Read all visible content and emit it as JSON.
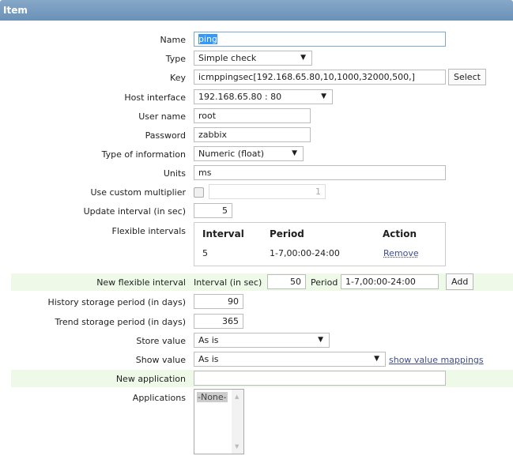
{
  "header": {
    "title": "Item"
  },
  "fields": {
    "name": {
      "label": "Name",
      "value": "ping"
    },
    "type": {
      "label": "Type",
      "value": "Simple check"
    },
    "key": {
      "label": "Key",
      "value": "icmppingsec[192.168.65.80,10,1000,32000,500,]",
      "button": "Select"
    },
    "host_interface": {
      "label": "Host interface",
      "value": "192.168.65.80 : 80"
    },
    "user_name": {
      "label": "User name",
      "value": "root"
    },
    "password": {
      "label": "Password",
      "value": "zabbix"
    },
    "type_of_information": {
      "label": "Type of information",
      "value": "Numeric (float)"
    },
    "units": {
      "label": "Units",
      "value": "ms"
    },
    "custom_multiplier": {
      "label": "Use custom multiplier",
      "checked": false,
      "value": "1"
    },
    "update_interval": {
      "label": "Update interval (in sec)",
      "value": "5"
    },
    "flexible_intervals": {
      "label": "Flexible intervals",
      "headers": [
        "Interval",
        "Period",
        "Action"
      ],
      "rows": [
        {
          "interval": "5",
          "period": "1-7,00:00-24:00",
          "action": "Remove"
        }
      ]
    },
    "new_flexible_interval": {
      "label": "New flexible interval",
      "interval_label": "Interval (in sec)",
      "interval_value": "50",
      "period_label": "Period",
      "period_value": "1-7,00:00-24:00",
      "button": "Add"
    },
    "history": {
      "label": "History storage period (in days)",
      "value": "90"
    },
    "trend": {
      "label": "Trend storage period (in days)",
      "value": "365"
    },
    "store_value": {
      "label": "Store value",
      "value": "As is"
    },
    "show_value": {
      "label": "Show value",
      "value": "As is",
      "link": "show value mappings"
    },
    "new_application": {
      "label": "New application",
      "value": ""
    },
    "applications": {
      "label": "Applications",
      "options": [
        "-None-"
      ]
    }
  },
  "icons": {
    "dropdown": "▼",
    "scroll_up": "▲",
    "scroll_down": "▼"
  }
}
